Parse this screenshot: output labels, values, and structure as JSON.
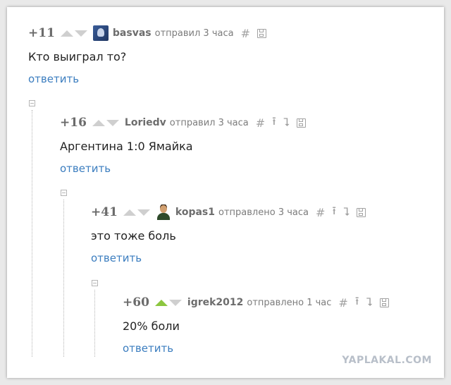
{
  "comments": [
    {
      "rating": "+11",
      "user": "basvas",
      "meta": "отправил 3 часа",
      "text": "Кто выиграл то?",
      "reply": "ответить",
      "avatar": "avatar-icon"
    },
    {
      "rating": "+16",
      "user": "Loriedv",
      "meta": "отправил 3 часа",
      "text": "Аргентина 1:0 Ямайка",
      "reply": "ответить"
    },
    {
      "rating": "+41",
      "user": "kopas1",
      "meta": "отправлено 3 часа",
      "text": "это тоже боль",
      "reply": "ответить",
      "avatar": "avatar-icon"
    },
    {
      "rating": "+60",
      "user": "igrek2012",
      "meta": "отправлено 1 час",
      "text": "20% боли",
      "reply": "ответить",
      "upvoted": true
    }
  ],
  "icons": {
    "hash": "#",
    "parent": "⭱",
    "thread": "⮧",
    "save": "save-icon"
  },
  "watermark": "YAPLAKAL.COM",
  "colors": {
    "reply_link": "#3b7dbf",
    "upvote_active": "#8cc63f",
    "vote_inactive": "#cfcfcf"
  }
}
